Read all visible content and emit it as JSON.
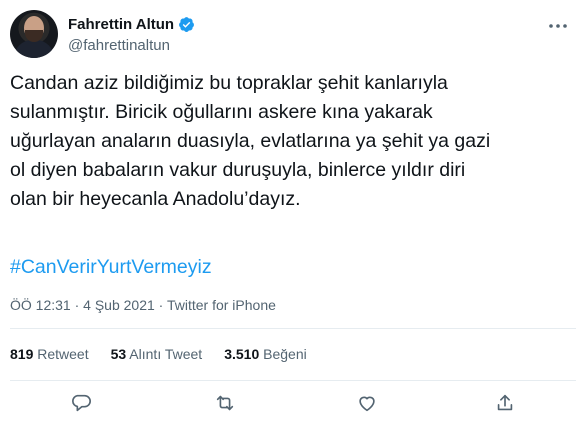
{
  "user": {
    "name": "Fahrettin Altun",
    "handle": "@fahrettinaltun"
  },
  "tweet": {
    "text": "Candan aziz bildiğimiz bu topraklar şehit kanlarıyla\nsulanmıştır. Biricik oğullarını askere kına yakarak\nuğurlayan anaların duasıyla, evlatlarına ya şehit ya gazi\nol diyen babaların vakur duruşuyla, binlerce yıldır diri\nolan bir heyecanla Anadolu’dayız.",
    "hashtag": "#CanVerirYurtVermeyiz",
    "meta": "ÖÖ 12:31 · 4 Şub 2021 · Twitter for iPhone"
  },
  "stats": {
    "retweets_count": "819",
    "retweets_label": " Retweet",
    "quotes_count": "53",
    "quotes_label": " Alıntı Tweet",
    "likes_count": "3.510",
    "likes_label": " Beğeni"
  },
  "colors": {
    "link": "#1d9bf0",
    "muted": "#536471",
    "text": "#0f1419"
  },
  "icons": [
    "verified-icon",
    "more-icon",
    "reply-icon",
    "retweet-icon",
    "like-icon",
    "share-icon"
  ]
}
